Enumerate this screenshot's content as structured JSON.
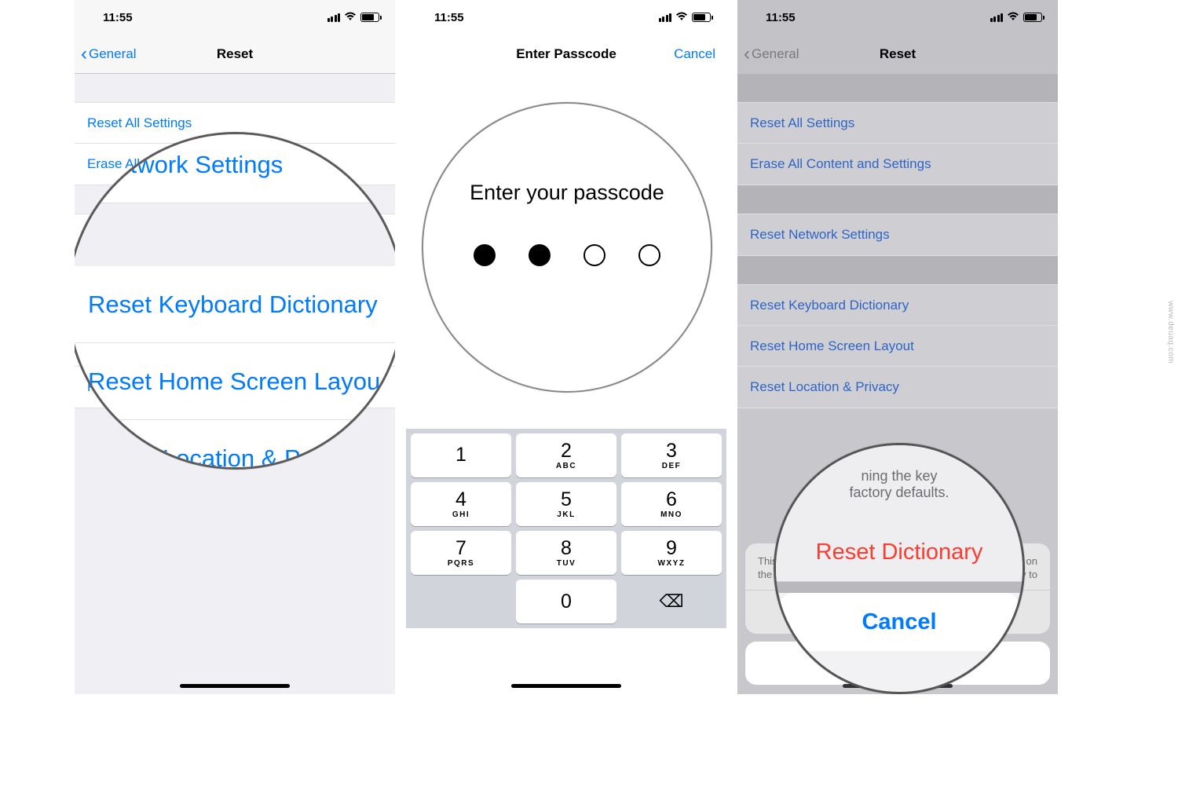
{
  "status": {
    "time": "11:55"
  },
  "phone1": {
    "nav": {
      "back": "General",
      "title": "Reset"
    },
    "items": {
      "resetAll": "Reset All Settings",
      "eraseAll": "Erase All Content and Settings",
      "resetNetwork": "Reset Network Settings",
      "resetKeyboard": "Reset Keyboard Dictionary",
      "resetHome": "Reset Home Screen Layout",
      "resetLocation": "Reset Location & Privacy"
    },
    "mag": {
      "network": "set Network Settings",
      "keyboard": "Reset Keyboard Dictionary",
      "home": "Reset Home Screen Layou",
      "location": "Location & Pr"
    }
  },
  "phone2": {
    "nav": {
      "title": "Enter Passcode",
      "cancel": "Cancel"
    },
    "label": "Enter your passcode",
    "magLabel": "Enter your passcode",
    "keypad": {
      "k1": {
        "n": "1",
        "l": ""
      },
      "k2": {
        "n": "2",
        "l": "ABC"
      },
      "k3": {
        "n": "3",
        "l": "DEF"
      },
      "k4": {
        "n": "4",
        "l": "GHI"
      },
      "k5": {
        "n": "5",
        "l": "JKL"
      },
      "k6": {
        "n": "6",
        "l": "MNO"
      },
      "k7": {
        "n": "7",
        "l": "PQRS"
      },
      "k8": {
        "n": "8",
        "l": "TUV"
      },
      "k9": {
        "n": "9",
        "l": "WXYZ"
      },
      "k0": {
        "n": "0",
        "l": ""
      },
      "del": "⌫"
    }
  },
  "phone3": {
    "nav": {
      "back": "General",
      "title": "Reset"
    },
    "items": {
      "resetAll": "Reset All Settings",
      "eraseAll": "Erase All Content and Settings",
      "resetNetwork": "Reset Network Settings",
      "resetKeyboard": "Reset Keyboard Dictionary",
      "resetHome": "Reset Home Screen Layout",
      "resetLocation": "Reset Location & Privacy"
    },
    "sheet": {
      "msg1": "This will",
      "msg2": "ped on",
      "msg3": "the k",
      "msg4": "ry to",
      "reset": "Reset Dictionary",
      "cancel": "Cancel"
    },
    "mag": {
      "top1": "ning the key",
      "top2": "factory defaults.",
      "reset": "Reset Dictionary",
      "cancel": "Cancel"
    }
  },
  "watermark": "www.deuaq.com"
}
